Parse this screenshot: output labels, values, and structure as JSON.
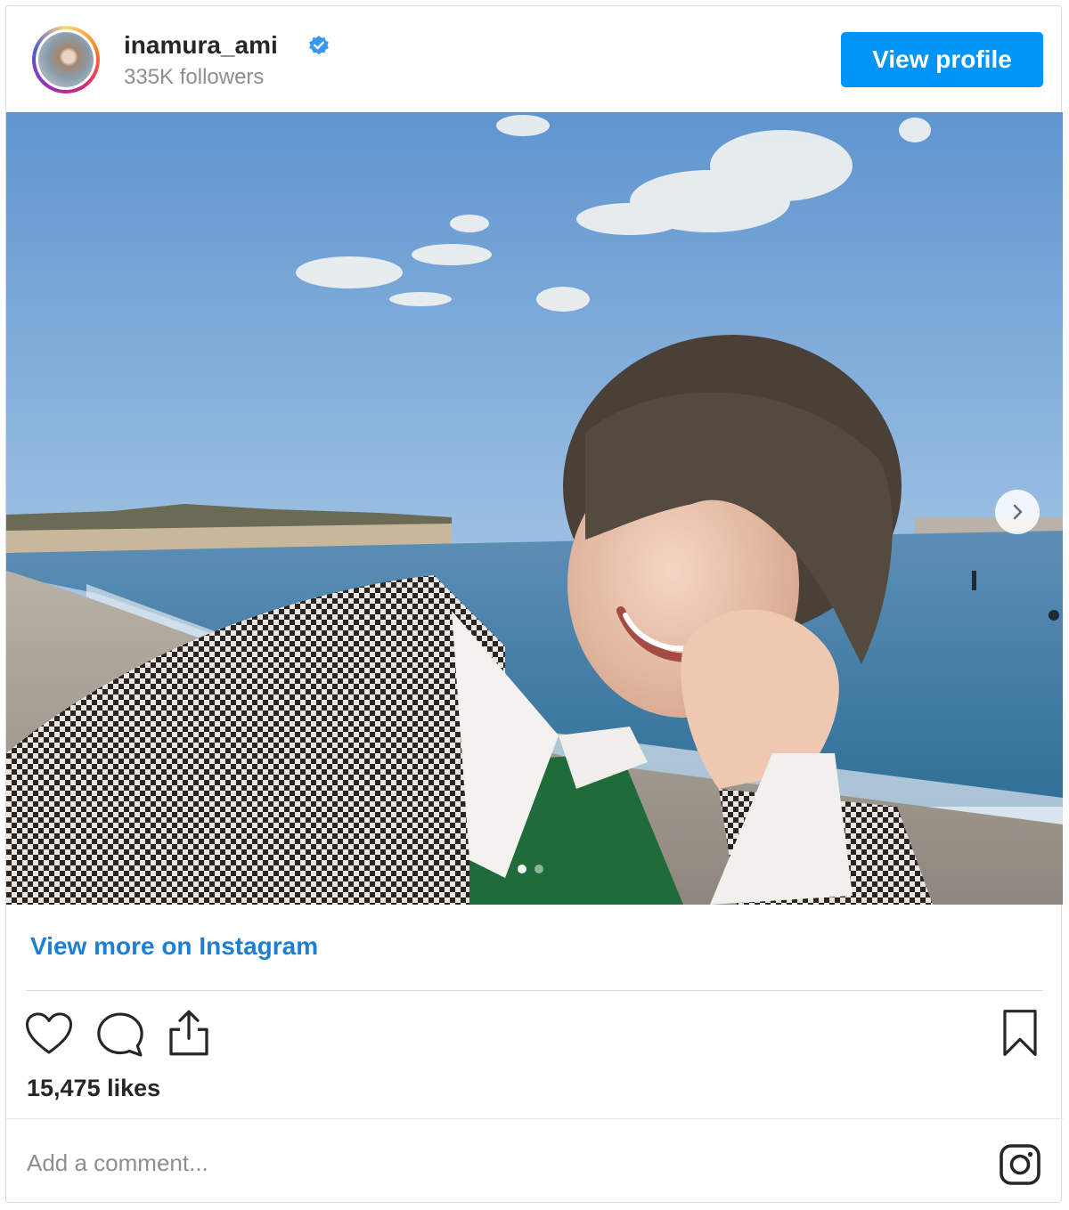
{
  "profile": {
    "username": "inamura_ami",
    "followers": "335K followers",
    "view_profile_label": "View profile"
  },
  "post": {
    "view_more_label": "View more on Instagram",
    "likes": "15,475 likes",
    "comment_placeholder": "Add a comment...",
    "carousel_total": 2,
    "carousel_current": 1
  },
  "colors": {
    "accent": "#0095f6",
    "link": "#1b7fd6",
    "verified": "#3897f0"
  },
  "icons": [
    "heart-icon",
    "comment-icon",
    "share-icon",
    "bookmark-icon",
    "instagram-icon",
    "chevron-right-icon",
    "verified-badge-icon"
  ]
}
